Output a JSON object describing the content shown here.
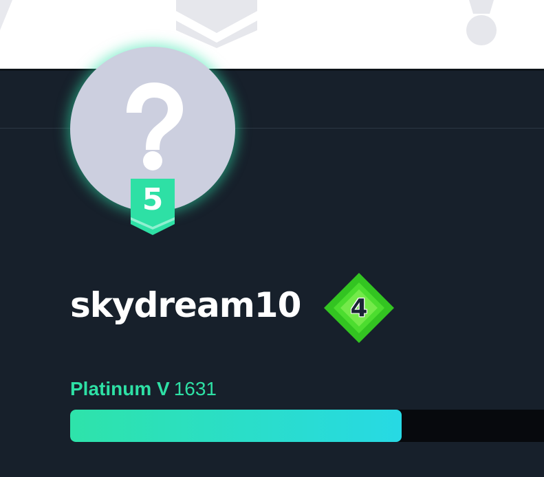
{
  "profile": {
    "username": "skydream10",
    "avatar_glyph": "?",
    "level_badge": "5",
    "rank_badge": "4",
    "tier_name": "Platinum V",
    "tier_points": "1631",
    "progress_fraction": 0.7
  },
  "colors": {
    "accent": "#2ee0a5",
    "background": "#17202b",
    "avatar_bg": "#cccfdf",
    "rank_green": "#3bd62c",
    "progress_start": "#2ee3aa",
    "progress_end": "#27d9e4"
  },
  "icons": {
    "top_center": "stack-layers-icon",
    "top_right": "exclamation-icon",
    "rank": "diamond-rank-icon",
    "level": "chevron-banner-icon"
  }
}
